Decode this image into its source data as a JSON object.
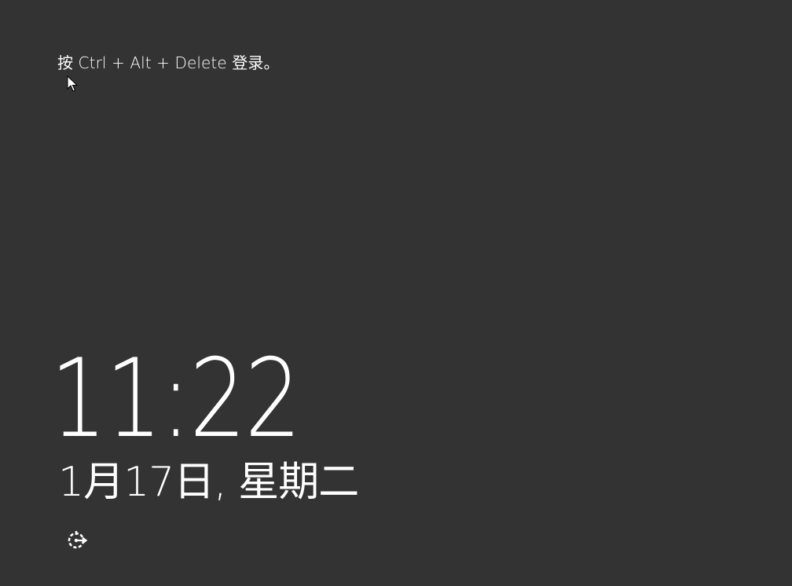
{
  "lock_screen": {
    "prompt": "按 Ctrl + Alt + Delete 登录。",
    "time": "11:22",
    "date": "1月17日, 星期二",
    "ease_of_access_icon": "ease-of-access-icon"
  },
  "colors": {
    "background": "#333333",
    "text": "#ffffff"
  }
}
